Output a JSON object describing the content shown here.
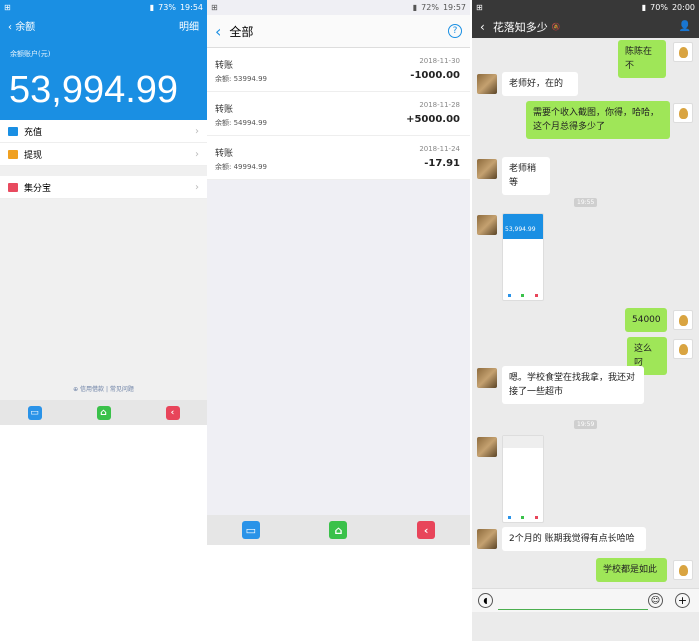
{
  "panel1": {
    "status": {
      "carrier_icons": "⊞",
      "battery": "73%",
      "time": "19:54"
    },
    "nav": {
      "back": "‹",
      "title": "余额",
      "detail": "明细"
    },
    "account_label": "余额账户(元)",
    "balance": "53,994.99",
    "menu": [
      {
        "label": "充值",
        "icon_color": "#1a8fe3"
      },
      {
        "label": "提现",
        "icon_color": "#f0a020"
      }
    ],
    "menu2": [
      {
        "label": "集分宝",
        "icon_color": "#e84a5f"
      }
    ],
    "footer": {
      "link1": "信用借款",
      "sep": "|",
      "link2": "常见问题"
    }
  },
  "panel2": {
    "status": {
      "battery": "72%",
      "time": "19:57"
    },
    "title": "全部",
    "help": "?",
    "transactions": [
      {
        "name": "转账",
        "balance": "余额: 53994.99",
        "date": "2018-11-30",
        "amount": "-1000.00"
      },
      {
        "name": "转账",
        "balance": "余额: 54994.99",
        "date": "2018-11-28",
        "amount": "+5000.00"
      },
      {
        "name": "转账",
        "balance": "余额: 49994.99",
        "date": "2018-11-24",
        "amount": "-17.91"
      }
    ]
  },
  "panel3": {
    "status": {
      "battery": "70%",
      "time": "20:00"
    },
    "title": "花落知多少",
    "messages": [
      {
        "side": "out",
        "text": "陈陈在不"
      },
      {
        "side": "in",
        "text": "老师好，在的"
      },
      {
        "side": "out",
        "text": "需要个收入截图，你得，哈哈，这个月总得多少了"
      },
      {
        "side": "in",
        "text": "老师稍等"
      },
      {
        "side": "out",
        "text": "54000"
      },
      {
        "side": "out",
        "text": "这么叼"
      },
      {
        "side": "in",
        "text": "嗯。学校食堂在找我拿，我还对接了一些超市"
      },
      {
        "side": "in",
        "text": "2个月的 账期我觉得有点长哈哈"
      },
      {
        "side": "out",
        "text": "学校都是如此"
      }
    ],
    "times": [
      "19:55",
      "19:59"
    ],
    "thumb_balance": "53,994.99"
  }
}
